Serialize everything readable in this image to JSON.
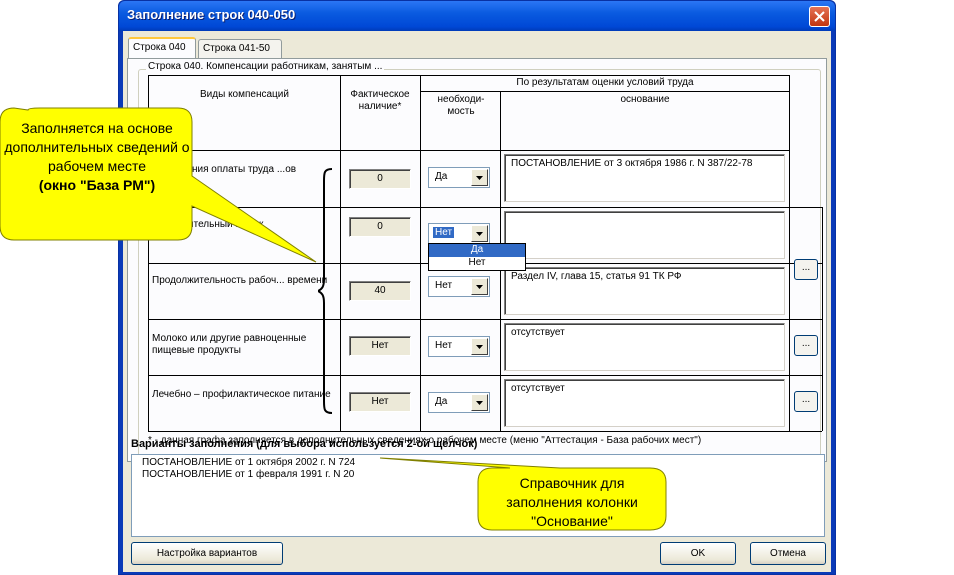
{
  "window": {
    "title": "Заполнение строк 040-050"
  },
  "tabs": [
    {
      "label": "Строка 040",
      "active": true
    },
    {
      "label": "Строка 041-50",
      "active": false
    }
  ],
  "group": {
    "caption": "Строка 040. Компенсации работникам, занятым ..."
  },
  "table": {
    "header": {
      "kinds": "Виды компенсаций",
      "actual": "Фактическое наличие*",
      "evaluation": "По результатам оценки условий труда",
      "necessity": "необходи- мость",
      "basis": "основание"
    },
    "rows": [
      {
        "name": "...овышения оплаты труда ...ов",
        "actual": "0",
        "necessity": "Да",
        "basis": "ПОСТАНОВЛЕНИЕ от 3 октября 1986 г. N 387/22-78",
        "dots": ""
      },
      {
        "name": "...ополнительный ...пуск",
        "actual": "0",
        "necessity": "Нет",
        "basis": "",
        "dots": "..."
      },
      {
        "name": "Продолжительность рабоч... времени",
        "actual": "40",
        "necessity": "Нет",
        "basis": "Раздел IV, глава 15, статья 91 ТК РФ",
        "dots": ""
      },
      {
        "name": "Молоко или другие равноценные пищевые продукты",
        "actual": "Нет",
        "necessity": "Нет",
        "basis": "отсутствует",
        "dots": "..."
      },
      {
        "name": "Лечебно – профилактическое питание",
        "actual": "Нет",
        "necessity": "Да",
        "basis": "отсутствует",
        "dots": "..."
      }
    ],
    "dropdown_options": [
      "Да",
      "Нет"
    ],
    "footnote": "* - данная графа заполняется в дополнительных сведениях о рабочем месте (меню \"Аттестация - База рабочих мест\")"
  },
  "variants": {
    "label": "Варианты заполнения (для выбора используется 2-ой щелчок)",
    "items": [
      "ПОСТАНОВЛЕНИЕ от 1 октября 2002 г. N 724",
      "ПОСТАНОВЛЕНИЕ от 1 февраля 1991 г. N 20"
    ]
  },
  "buttons": {
    "settings": "Настройка вариантов",
    "ok": "OK",
    "cancel": "Отмена"
  },
  "callouts": {
    "left": {
      "line1": "Заполняется на основе дополнительных сведений о рабочем месте",
      "line2": "(окно \"База РМ\")"
    },
    "right": "Справочник для заполнения колонки \"Основание\""
  },
  "colors": {
    "callout_fill": "#ffff00",
    "titlebar": "#0a5be0",
    "dialog_bg": "#ece9d8"
  }
}
